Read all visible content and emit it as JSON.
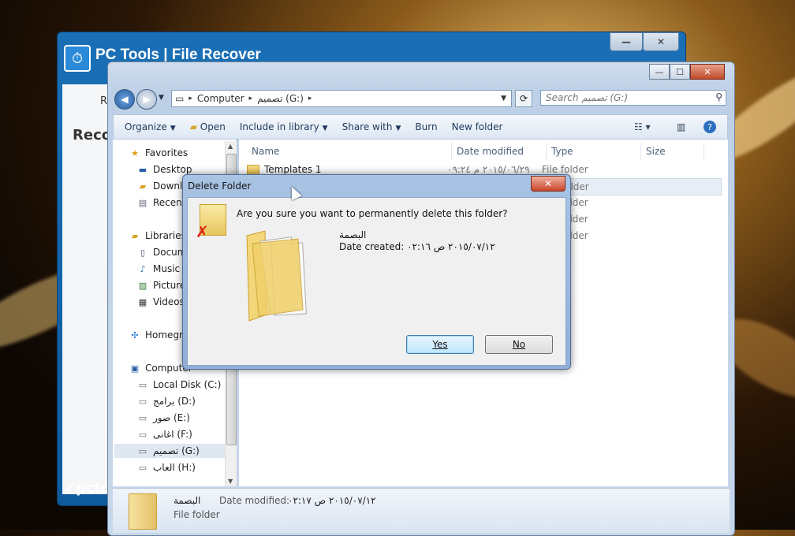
{
  "pctools": {
    "title": "PC Tools  |  File Recover",
    "side_letter": "R",
    "side_heading": "Reco",
    "footer_logo": "pcto",
    "minimize_label": "—",
    "close_label": "✕"
  },
  "explorer": {
    "titlebar_buttons": [
      "—",
      "☐",
      "✕"
    ],
    "breadcrumb": [
      "Computer",
      "تصميم (G:)"
    ],
    "search_placeholder": "Search تصميم (G:)",
    "commands": [
      {
        "label": "Organize",
        "dropdown": true
      },
      {
        "label": "Open",
        "dropdown": false
      },
      {
        "label": "Include in library",
        "dropdown": true
      },
      {
        "label": "Share with",
        "dropdown": true
      },
      {
        "label": "Burn",
        "dropdown": false
      },
      {
        "label": "New folder",
        "dropdown": false
      }
    ],
    "nav": {
      "favorites": {
        "label": "Favorites",
        "items": [
          "Desktop",
          "Downloads",
          "Recent Places"
        ]
      },
      "libraries": {
        "label": "Libraries",
        "items": [
          "Documents",
          "Music",
          "Pictures",
          "Videos"
        ]
      },
      "homegroup": "Homegroup",
      "computer": {
        "label": "Computer",
        "items": [
          "Local Disk (C:)",
          "برامج (D:)",
          "صور (E:)",
          "اغانى  (F:)",
          "تصميم (G:)",
          "العاب (H:)"
        ]
      },
      "selected": "تصميم (G:)"
    },
    "columns": [
      "Name",
      "Date modified",
      "Type",
      "Size"
    ],
    "rows": [
      {
        "name": "Templates 1",
        "date": "٢٠١٥/٠٦/٢٩ م ٠٩:٢٤",
        "type": "File folder"
      },
      {
        "name": "",
        "date": "",
        "type": "File folder"
      },
      {
        "name": "",
        "date": "",
        "type": "File folder"
      },
      {
        "name": "",
        "date": "",
        "type": "File folder"
      },
      {
        "name": "",
        "date": "",
        "type": "File folder"
      }
    ],
    "details": {
      "name": "البصمة",
      "type": "File folder",
      "date_label": "Date modified:",
      "date_value": "٢٠١٥/٠٧/١٢ ص ٠٢:١٧"
    }
  },
  "dialog": {
    "title": "Delete Folder",
    "close_label": "✕",
    "question": "Are you sure you want to permanently delete this folder?",
    "folder_name": "البصمة",
    "date_created": "Date created: ٢٠١٥/٠٧/١٢ ص ٠٢:١٦",
    "yes_label": "Yes",
    "no_label": "No"
  }
}
